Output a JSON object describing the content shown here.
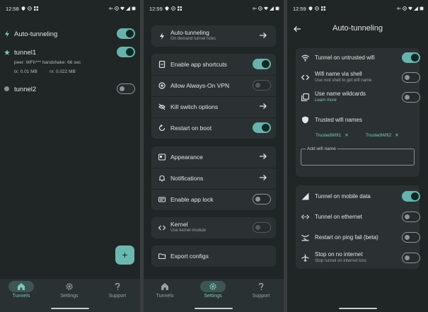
{
  "screens": {
    "tunnels": {
      "status_time": "12:58",
      "auto_tunneling": {
        "label": "Auto-tunneling",
        "enabled": true
      },
      "tunnels": [
        {
          "name": "tunnel1",
          "enabled": true,
          "peer": "peer: WFh*** handshake: 66 sec",
          "tx": "tx: 0.01 MB",
          "rx": "rx: 0.022 MB"
        },
        {
          "name": "tunnel2",
          "enabled": false
        }
      ],
      "fab_label": "+"
    },
    "settings": {
      "status_time": "12:59",
      "auto_tunneling": {
        "label": "Auto-tunneling",
        "sub": "On demand tunnel rules"
      },
      "group1": [
        {
          "label": "Enable app shortcuts",
          "type": "toggle",
          "on": true
        },
        {
          "label": "Allow Always-On VPN",
          "type": "toggle",
          "on": false,
          "disabled": true
        },
        {
          "label": "Kill switch options",
          "type": "arrow"
        },
        {
          "label": "Restart on boot",
          "type": "toggle",
          "on": true
        }
      ],
      "group2": [
        {
          "label": "Appearance",
          "type": "arrow"
        },
        {
          "label": "Notifications",
          "type": "arrow"
        },
        {
          "label": "Enable app lock",
          "type": "toggle",
          "on": false
        }
      ],
      "kernel": {
        "label": "Kernel",
        "sub": "Use kernel module",
        "on": false
      },
      "export": {
        "label": "Export configs"
      }
    },
    "auto_tunneling": {
      "status_time": "12:59",
      "title": "Auto-tunneling",
      "wifi_card": {
        "untrusted": {
          "label": "Tunnel on untrusted wifi",
          "on": true
        },
        "via_shell": {
          "label": "Wifi name via shell",
          "sub": "Use root shell to get wifi name",
          "on": false
        },
        "wildcards": {
          "label": "Use name wildcards",
          "sub": "Learn more",
          "on": false
        },
        "trusted_title": "Trusted wifi names",
        "trusted": [
          "TrustedWifi1",
          "TrustedWifi2"
        ],
        "chip_remove": "✕",
        "add_label": "Add wifi name",
        "add_value": ""
      },
      "other_card": [
        {
          "label": "Tunnel on mobile data",
          "on": true
        },
        {
          "label": "Tunnel on ethernet",
          "on": false
        },
        {
          "label": "Restart on ping fail (beta)",
          "on": false
        },
        {
          "label": "Stop on no internet",
          "sub": "Stop tunnel on internet loss",
          "on": false
        }
      ]
    }
  },
  "nav": {
    "items": [
      {
        "label": "Tunnels",
        "icon": "home-icon"
      },
      {
        "label": "Settings",
        "icon": "gear-icon"
      },
      {
        "label": "Support",
        "icon": "question-icon"
      }
    ]
  },
  "colors": {
    "accent": "#6cb8b1",
    "background": "#202526",
    "card": "#2b3132"
  }
}
